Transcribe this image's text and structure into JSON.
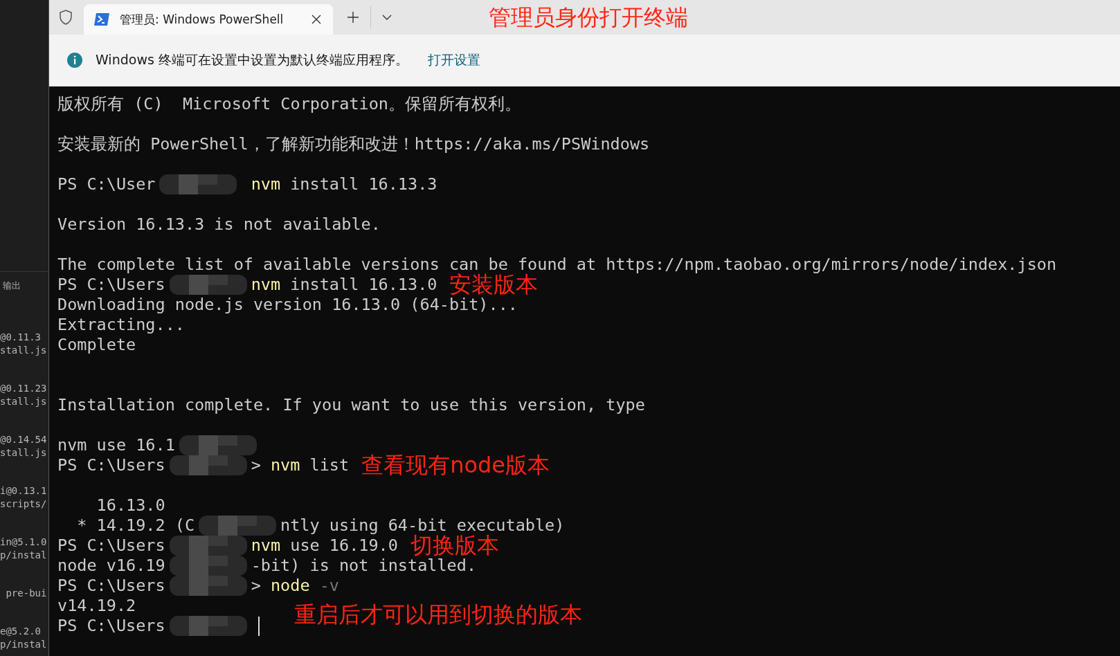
{
  "background_editor": {
    "panel_tab": "输出",
    "groups": [
      [
        "@0.11.3",
        "stall.js"
      ],
      [
        "@0.11.23",
        "stall.js"
      ],
      [
        "@0.14.54",
        "stall.js"
      ],
      [
        "i@0.13.1",
        "scripts/"
      ],
      [
        "in@5.1.0",
        "p/instal"
      ],
      [
        " pre-bui"
      ],
      [
        "e@5.2.0",
        "p/instal"
      ]
    ]
  },
  "tabs": [
    {
      "title": "管理员: Windows PowerShell",
      "selected": true
    }
  ],
  "tab_annotation": "管理员身份打开终端",
  "info_bar": {
    "message": "Windows 终端可在设置中设置为默认终端应用程序。",
    "link": "打开设置"
  },
  "terminal_lines": [
    {
      "kind": "text",
      "segments": [
        {
          "kind": "plain",
          "text": "版权所有 (C)  Microsoft Corporation。保留所有权利。"
        }
      ]
    },
    {
      "kind": "blank"
    },
    {
      "kind": "text",
      "segments": [
        {
          "kind": "plain",
          "text": "安装最新的 PowerShell，了解新功能和改进！https://aka.ms/PSWindows"
        }
      ]
    },
    {
      "kind": "blank"
    },
    {
      "kind": "text",
      "segments": [
        {
          "kind": "plain",
          "text": "PS C:\\User"
        },
        {
          "kind": "redacted"
        },
        {
          "kind": "command",
          "text": " nvm"
        },
        {
          "kind": "plain",
          "text": " install 16.13.3"
        }
      ]
    },
    {
      "kind": "blank"
    },
    {
      "kind": "text",
      "segments": [
        {
          "kind": "plain",
          "text": "Version 16.13.3 is not available."
        }
      ]
    },
    {
      "kind": "blank"
    },
    {
      "kind": "text",
      "segments": [
        {
          "kind": "plain",
          "text": "The complete list of available versions can be found at https://npm.taobao.org/mirrors/node/index.json"
        }
      ]
    },
    {
      "kind": "text",
      "segments": [
        {
          "kind": "plain",
          "text": "PS C:\\Users"
        },
        {
          "kind": "redacted"
        },
        {
          "kind": "command",
          "text": "nvm"
        },
        {
          "kind": "plain",
          "text": " install 16.13.0"
        },
        {
          "kind": "note",
          "text": "安装版本"
        }
      ]
    },
    {
      "kind": "text",
      "segments": [
        {
          "kind": "plain",
          "text": "Downloading node.js version 16.13.0 (64-bit)..."
        }
      ]
    },
    {
      "kind": "text",
      "segments": [
        {
          "kind": "plain",
          "text": "Extracting..."
        }
      ]
    },
    {
      "kind": "text",
      "segments": [
        {
          "kind": "plain",
          "text": "Complete"
        }
      ]
    },
    {
      "kind": "blank"
    },
    {
      "kind": "blank"
    },
    {
      "kind": "text",
      "segments": [
        {
          "kind": "plain",
          "text": "Installation complete. If you want to use this version, type"
        }
      ]
    },
    {
      "kind": "blank"
    },
    {
      "kind": "text",
      "segments": [
        {
          "kind": "plain",
          "text": "nvm use 16.1"
        },
        {
          "kind": "redacted"
        }
      ]
    },
    {
      "kind": "text",
      "segments": [
        {
          "kind": "plain",
          "text": "PS C:\\Users"
        },
        {
          "kind": "redacted"
        },
        {
          "kind": "plain",
          "text": ">"
        },
        {
          "kind": "command",
          "text": " nvm"
        },
        {
          "kind": "plain",
          "text": " list"
        },
        {
          "kind": "note",
          "text": "查看现有node版本"
        }
      ]
    },
    {
      "kind": "blank"
    },
    {
      "kind": "text",
      "segments": [
        {
          "kind": "plain",
          "text": "    16.13.0"
        }
      ]
    },
    {
      "kind": "text",
      "segments": [
        {
          "kind": "plain",
          "text": "  * 14.19.2 (C"
        },
        {
          "kind": "redacted"
        },
        {
          "kind": "plain",
          "text": "ntly using 64-bit executable)"
        }
      ]
    },
    {
      "kind": "text",
      "segments": [
        {
          "kind": "plain",
          "text": "PS C:\\Users"
        },
        {
          "kind": "redacted"
        },
        {
          "kind": "command",
          "text": "nvm"
        },
        {
          "kind": "plain",
          "text": " use 16.19.0"
        },
        {
          "kind": "note",
          "text": "切换版本"
        }
      ]
    },
    {
      "kind": "text",
      "segments": [
        {
          "kind": "plain",
          "text": "node v16.19"
        },
        {
          "kind": "redacted"
        },
        {
          "kind": "plain",
          "text": "-bit) is not installed."
        }
      ]
    },
    {
      "kind": "text",
      "segments": [
        {
          "kind": "plain",
          "text": "PS C:\\Users"
        },
        {
          "kind": "redacted"
        },
        {
          "kind": "plain",
          "text": ">"
        },
        {
          "kind": "command",
          "text": " node"
        },
        {
          "kind": "flag",
          "text": " -v"
        }
      ]
    },
    {
      "kind": "text",
      "segments": [
        {
          "kind": "plain",
          "text": "v14.19.2"
        }
      ]
    },
    {
      "kind": "text",
      "segments": [
        {
          "kind": "plain",
          "text": "PS C:\\Users"
        },
        {
          "kind": "redacted"
        },
        {
          "kind": "cursor"
        },
        {
          "kind": "note_below",
          "text": "重启后才可以用到切换的版本"
        }
      ]
    }
  ]
}
